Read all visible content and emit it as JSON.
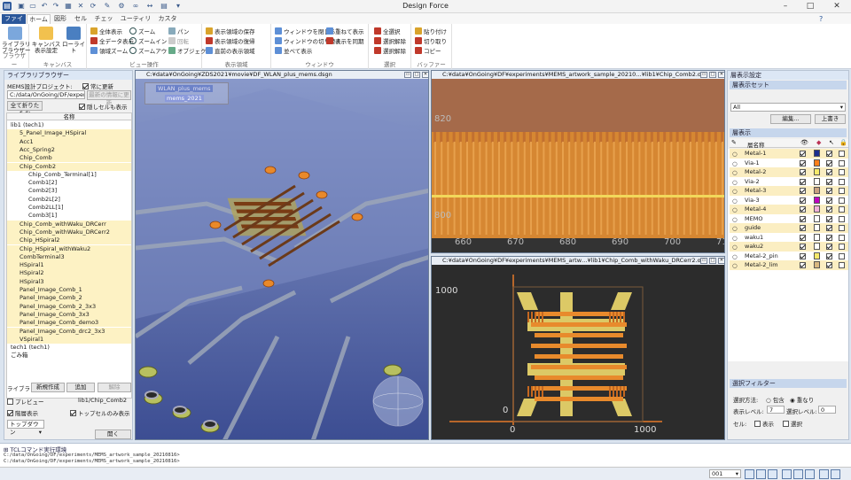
{
  "app": {
    "title": "Design Force"
  },
  "tabs": [
    "ファイル",
    "ホーム",
    "図形",
    "セル",
    "チェック",
    "ユーティリティ",
    "カスタム"
  ],
  "ribbon": {
    "browser": {
      "big1": "ライブラリ\nブラウザー",
      "label": "ブラウザー"
    },
    "canvas": {
      "big1": "キャンバス\n表示設定",
      "big2": "ローライト",
      "label": "キャンバス"
    },
    "view": {
      "items": [
        "全体表示",
        "全データ表示",
        "領域ズーム",
        "ズーム",
        "ズームイン",
        "ズームアウト",
        "パン",
        "回転",
        "オブジェクト"
      ],
      "label": "ビュー操作"
    },
    "display": {
      "items": [
        "表示領域の保存",
        "表示領域の復帰",
        "直前の表示領域"
      ],
      "label": "表示領域"
    },
    "window": {
      "items": [
        "ウィンドウを閉じる",
        "ウィンドウの切り替え",
        "並べて表示",
        "重ねて表示",
        "表示を同期"
      ],
      "label": "ウィンドウ"
    },
    "select": {
      "items": [
        "全選択",
        "選択解除",
        "選択解除"
      ],
      "label": "選択"
    },
    "buffer": {
      "items": [
        "貼り付け",
        "切り取り",
        "コピー"
      ],
      "label": "バッファー"
    }
  },
  "library_panel": {
    "title": "ライブラリブラウザー",
    "project_label": "MEMS設計プロジェクト:",
    "auto_update": "常に更新",
    "path": "C:/data/OnGoing/DF/experim",
    "latest_btn": "最新の情報に更新",
    "collapse_btn": "全て折りたたむ",
    "show_hidden": "隠しセルも表示する",
    "col_header": "名称",
    "tree": [
      "lib1 (tech1)",
      "5_Panel_Image_HSpiral",
      "Acc1",
      "Acc_Spring2",
      "Chip_Comb",
      "Chip_Comb2",
      "Chip_Comb_Terminal[1]",
      "Comb1[2]",
      "Comb2[3]",
      "Comb2L[2]",
      "Comb2LL[1]",
      "Comb3[1]",
      "Chip_Comb_withWaku_DRCerr",
      "Chip_Comb_withWaku_DRCerr2",
      "Chip_HSpiral2",
      "Chip_HSpiral_withWaku2",
      "CombTerminal3",
      "HSpiral1",
      "HSpiral2",
      "HSpiral3",
      "Panel_Image_Comb_1",
      "Panel_Image_Comb_2",
      "Panel_Image_Comb_2_3x3",
      "Panel_Image_Comb_3x3",
      "Panel_Image_Comb_demo3",
      "Panel_Image_Comb_drc2_3x3",
      "VSpiral1",
      "tech1 (tech1)",
      "ごみ箱"
    ],
    "lib_label": "ライブラリ:",
    "new_btn": "新規作成",
    "add_btn": "追加",
    "remove_btn": "解除",
    "preview": "プレビュー",
    "preview_value": "lib1/Chip_Comb2",
    "layer_show": "階層表示",
    "top_only": "トップセルのみ表示",
    "topdown": "トップダウン",
    "open_btn": "開く"
  },
  "views": {
    "v3d": {
      "title": "C:¥data¥OnGoing¥ZDS2021¥movie¥DF_WLAN_plus_mems.dsgn",
      "items": [
        "WLAN_plus_mems",
        "mems_2021"
      ]
    },
    "v2": {
      "title": "C:¥data¥OnGoing¥DF¥experiments¥MEMS_artwork_sample_20210…¥lib1¥Chip_Comb2.oa",
      "xticks": [
        "660",
        "670",
        "680",
        "690",
        "700",
        "710"
      ],
      "yticks": [
        "820",
        "800"
      ]
    },
    "v3": {
      "title": "C:¥data¥OnGoing¥DF¥experiments¥MEMS_artw…¥lib1¥Chip_Comb_withWaku_DRCerr2.oa",
      "xticks": [
        "0",
        "1000"
      ],
      "yticks": [
        "1000",
        "0"
      ]
    }
  },
  "right_panel": {
    "settings_title": "層表示設定",
    "layerset_hdr": "層表示セット",
    "layerset_value": "All",
    "edit_btn": "編集...",
    "overwrite_btn": "上書き",
    "layer_hdr": "層表示",
    "col_name": "層名称",
    "layers": [
      {
        "name": "Metal-1",
        "color": "#1c2f8f",
        "c1": true,
        "c2": true,
        "c3": false
      },
      {
        "name": "Via-1",
        "color": "#ff7f1a",
        "c1": true,
        "c2": true,
        "c3": false
      },
      {
        "name": "Metal-2",
        "color": "#f5e96a",
        "c1": true,
        "c2": true,
        "c3": false
      },
      {
        "name": "Via-2",
        "color": "#ffffff",
        "c1": true,
        "c2": true,
        "c3": false
      },
      {
        "name": "Metal-3",
        "color": "#c8a080",
        "c1": true,
        "c2": true,
        "c3": false
      },
      {
        "name": "Via-3",
        "color": "#c000c0",
        "c1": true,
        "c2": true,
        "c3": false
      },
      {
        "name": "Metal-4",
        "color": "#f0b0d8",
        "c1": true,
        "c2": true,
        "c3": false
      },
      {
        "name": "MEMO",
        "color": "#ffffff",
        "c1": true,
        "c2": true,
        "c3": false
      },
      {
        "name": "guide",
        "color": "#ffffff",
        "c1": true,
        "c2": true,
        "c3": false
      },
      {
        "name": "waku1",
        "color": "#ffffff",
        "c1": true,
        "c2": true,
        "c3": false
      },
      {
        "name": "waku2",
        "color": "#ffffff",
        "c1": true,
        "c2": true,
        "c3": false
      },
      {
        "name": "Metal-2_pin",
        "color": "#f5e96a",
        "c1": true,
        "c2": true,
        "c3": false
      },
      {
        "name": "Metal-2_lim",
        "color": "#d8b880",
        "c1": true,
        "c2": true,
        "c3": false
      }
    ],
    "filter_hdr": "選択フィルター",
    "sel_method": "選択方法:",
    "include": "包含",
    "overlap": "重なり",
    "disp_level": "表示レベル:",
    "disp_level_val": "7",
    "sel_level": "選択レベル:",
    "sel_level_val": "0",
    "cell": "セル:",
    "show": "表示",
    "select": "選択"
  },
  "tcl": {
    "title": "TCLコマンド実行環境",
    "lines": [
      "C:/data/OnGoing/DF/experiments/MEMS_artwork_sample_20210816>",
      "C:/data/OnGoing/DF/experiments/MEMS_artwork_sample_20210816>"
    ]
  },
  "status": {
    "layer_value": "001"
  }
}
